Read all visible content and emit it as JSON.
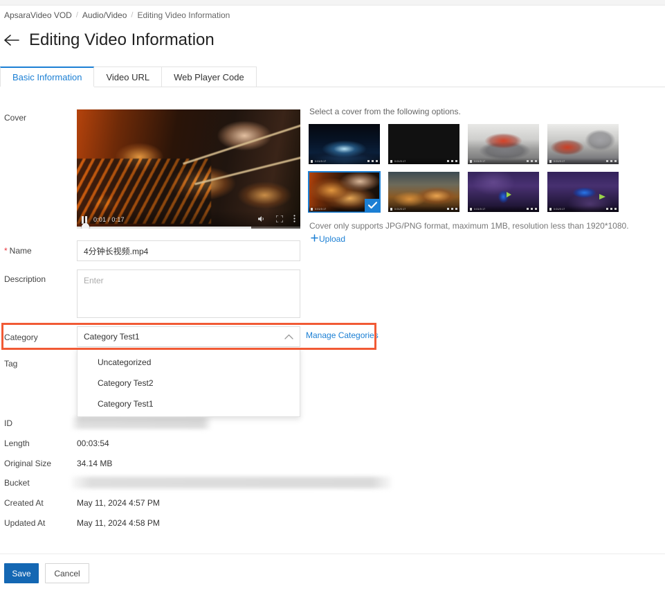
{
  "breadcrumb": {
    "items": [
      "ApsaraVideo VOD",
      "Audio/Video",
      "Editing Video Information"
    ],
    "separator": "/"
  },
  "header": {
    "title": "Editing Video Information",
    "back_icon": "arrow-left-icon"
  },
  "tabs": [
    {
      "label": "Basic Information",
      "active": true
    },
    {
      "label": "Video URL",
      "active": false
    },
    {
      "label": "Web Player Code",
      "active": false
    }
  ],
  "form": {
    "cover": {
      "label": "Cover",
      "player": {
        "time": "0:01 / 0:17",
        "pause_icon": "pause-icon",
        "volume_icon": "volume-icon",
        "fullscreen_icon": "fullscreen-icon",
        "menu_icon": "more-vertical-icon",
        "progress_percent": 78
      },
      "hint": "Select a cover from the following options.",
      "note": "Cover only supports JPG/PNG format, maximum 1MB, resolution less than 1920*1080.",
      "upload_label": "Upload",
      "upload_icon": "plus-icon",
      "thumbnails": [
        {
          "name": "cover-thumb-1",
          "scene": "space-earth",
          "selected": false
        },
        {
          "name": "cover-thumb-2",
          "scene": "space-earth-2",
          "selected": false
        },
        {
          "name": "cover-thumb-3",
          "scene": "crab-pot",
          "selected": false
        },
        {
          "name": "cover-thumb-4",
          "scene": "crab-pan",
          "selected": false
        },
        {
          "name": "cover-thumb-5",
          "scene": "grilled-squid",
          "selected": true
        },
        {
          "name": "cover-thumb-6",
          "scene": "grilled-squid-2",
          "selected": false
        },
        {
          "name": "cover-thumb-7",
          "scene": "blue-fish",
          "selected": false
        },
        {
          "name": "cover-thumb-8",
          "scene": "blue-fish-2",
          "selected": false
        }
      ]
    },
    "name": {
      "label": "Name",
      "required_mark": "*",
      "value": "4分钟长视频.mp4"
    },
    "description": {
      "label": "Description",
      "value": "",
      "placeholder": "Enter"
    },
    "category": {
      "label": "Category",
      "value": "Category Test1",
      "caret_icon": "chevron-up-icon",
      "manage_link": "Manage Categories",
      "options": [
        "Uncategorized",
        "Category Test2",
        "Category Test1"
      ]
    },
    "tag": {
      "label": "Tag",
      "value": ""
    }
  },
  "meta": [
    {
      "label": "ID",
      "value": "",
      "redacted": true
    },
    {
      "label": "Length",
      "value": "00:03:54",
      "redacted": false
    },
    {
      "label": "Original Size",
      "value": "34.14 MB",
      "redacted": false
    },
    {
      "label": "Bucket",
      "value": "",
      "redacted": true
    },
    {
      "label": "Created At",
      "value": "May 11, 2024 4:57 PM",
      "redacted": false
    },
    {
      "label": "Updated At",
      "value": "May 11, 2024 4:58 PM",
      "redacted": false
    }
  ],
  "footer": {
    "save_label": "Save",
    "cancel_label": "Cancel"
  },
  "colors": {
    "accent_blue": "#1b7fd4",
    "primary_button": "#1467b3",
    "highlight_red": "#f15a35",
    "required_red": "#e8353d"
  }
}
